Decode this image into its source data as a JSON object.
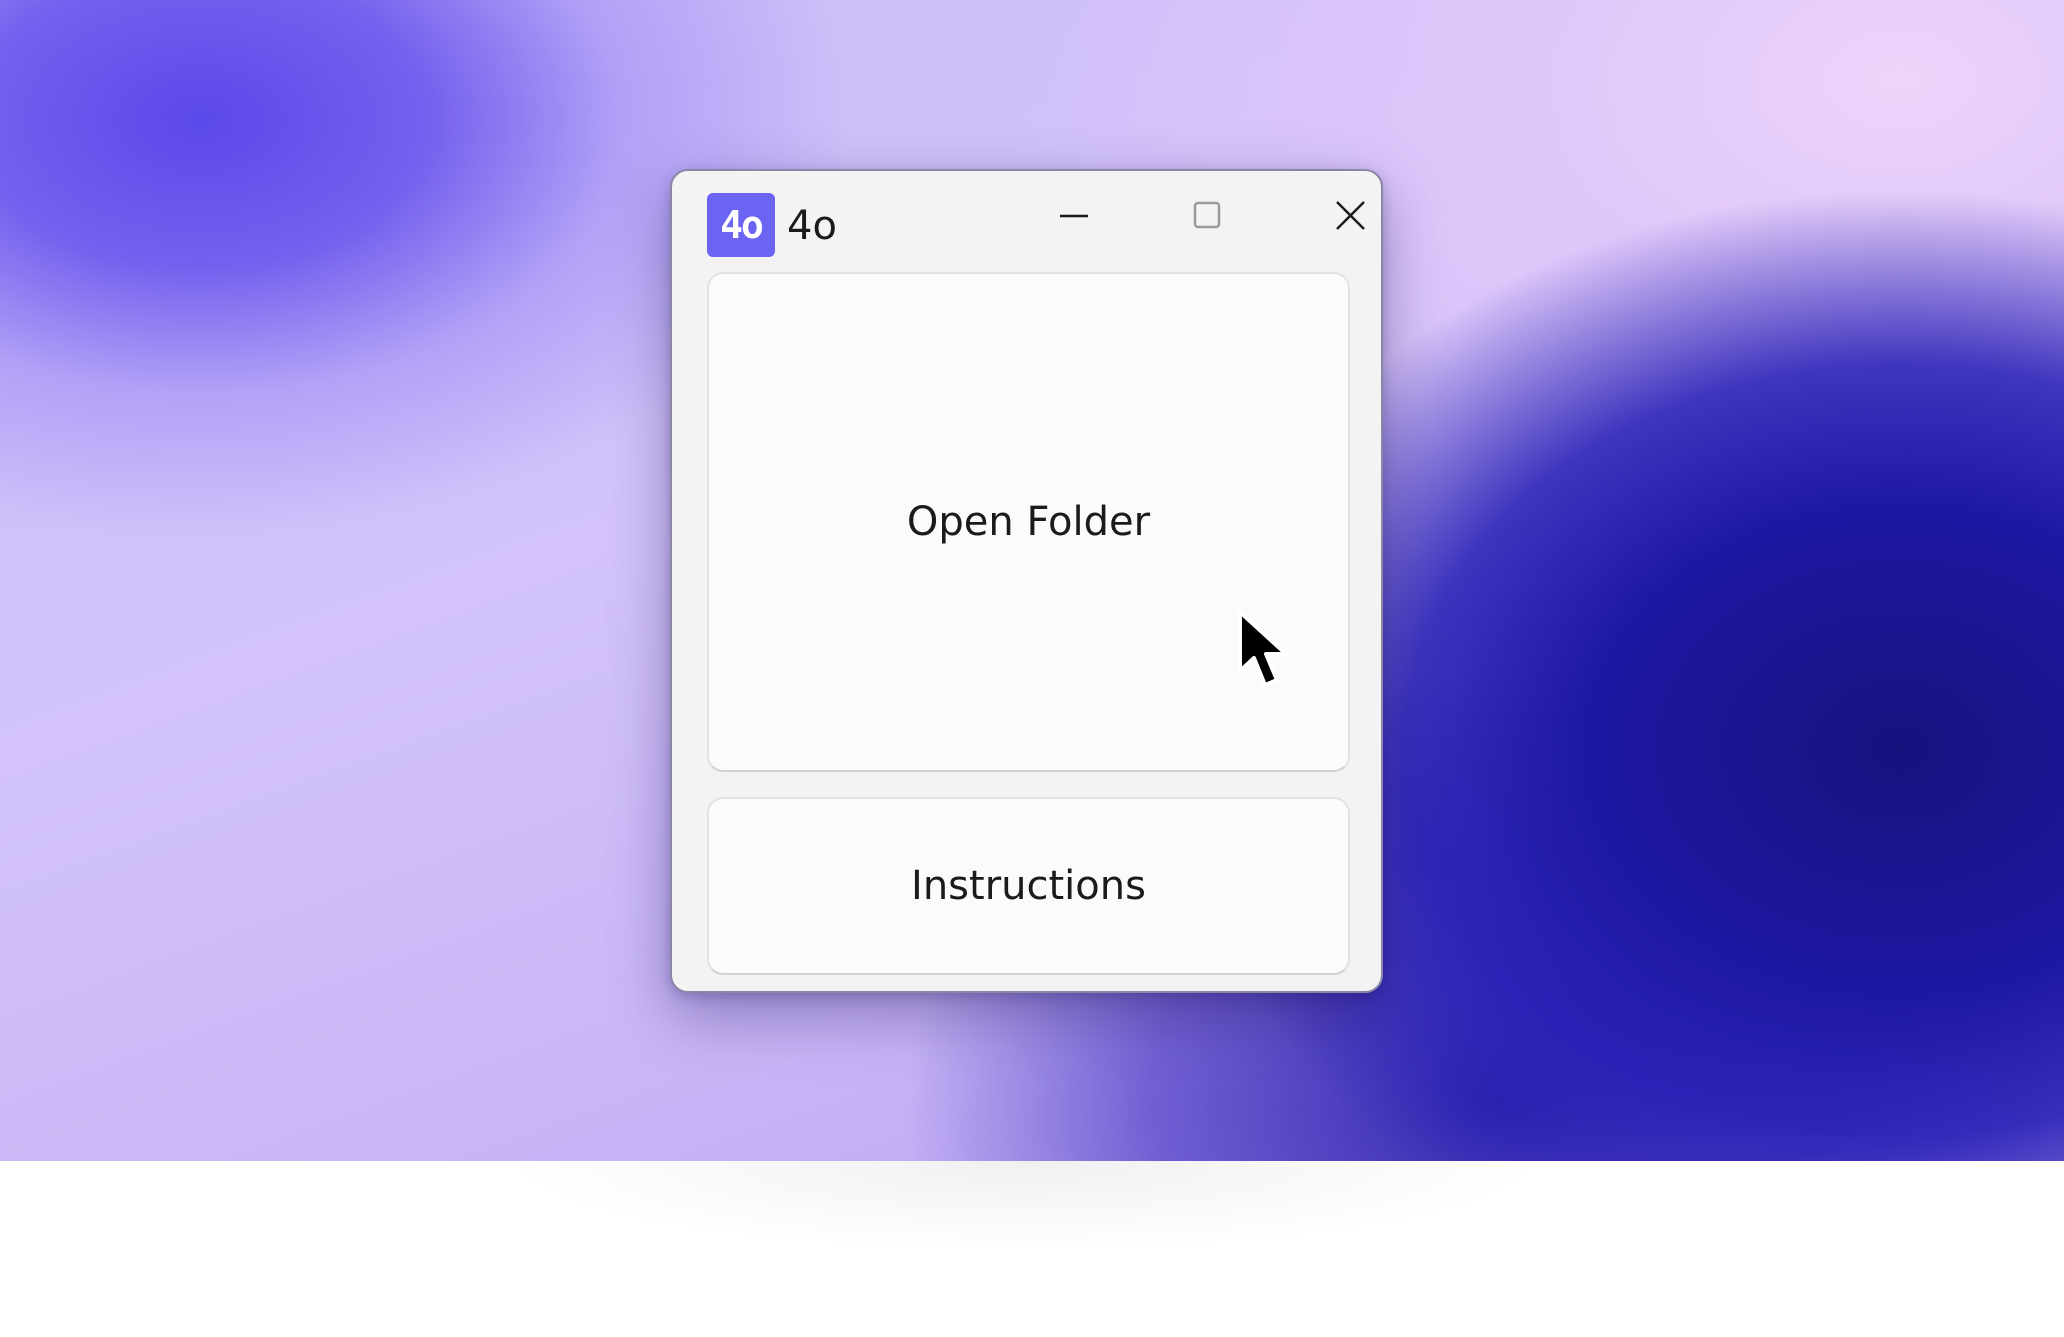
{
  "window": {
    "title": "4o",
    "icon_text": "4o",
    "icon": "app-logo-icon",
    "accent_color": "#6b64f2"
  },
  "titlebar": {
    "minimize_icon": "minimize-icon",
    "maximize_icon": "maximize-icon",
    "close_icon": "close-icon"
  },
  "main": {
    "open_folder_label": "Open Folder",
    "instructions_label": "Instructions"
  },
  "cursor": {
    "icon": "mouse-pointer-icon"
  }
}
